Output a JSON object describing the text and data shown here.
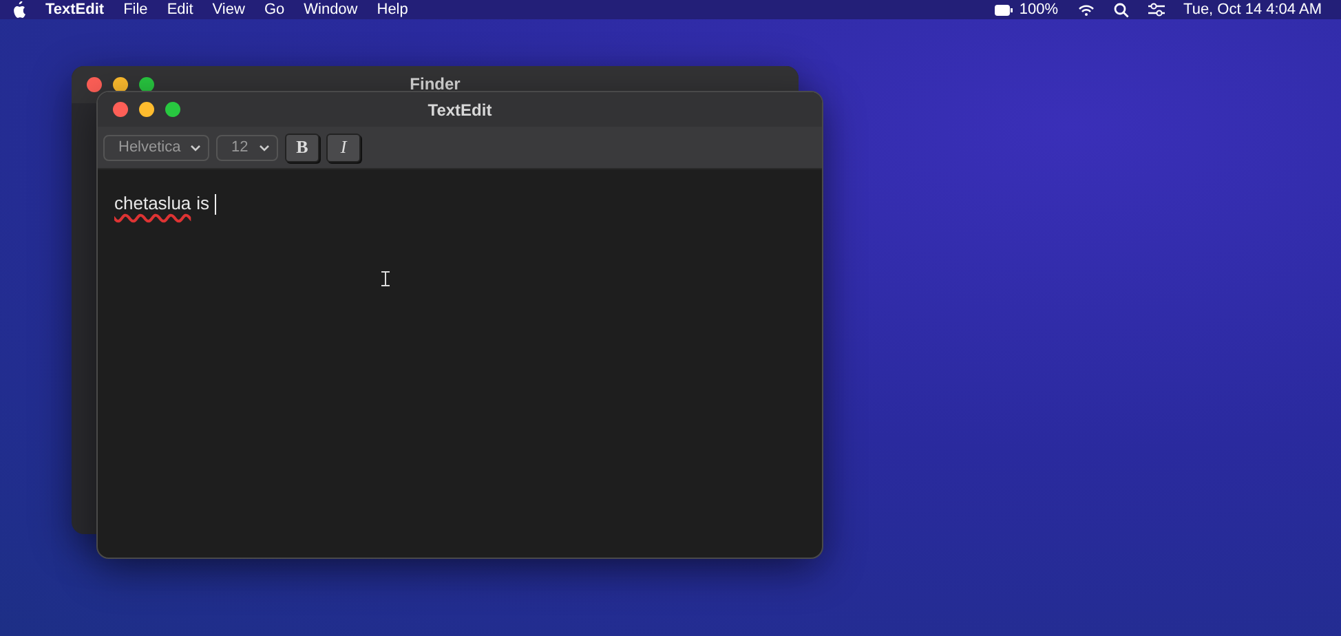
{
  "menu_bar": {
    "app_name": "TextEdit",
    "items": [
      "File",
      "Edit",
      "View",
      "Go",
      "Window",
      "Help"
    ],
    "battery": "100%",
    "clock": "Tue, Oct 14 4:04 AM"
  },
  "background_window": {
    "title": "Finder"
  },
  "window": {
    "title": "TextEdit",
    "toolbar": {
      "font": "Helvetica",
      "size": "12",
      "bold": "B",
      "italic": "I"
    },
    "document": {
      "words": [
        {
          "text": "chetaslua",
          "misspelled": true
        },
        {
          "text": "is",
          "misspelled": false
        }
      ]
    }
  }
}
